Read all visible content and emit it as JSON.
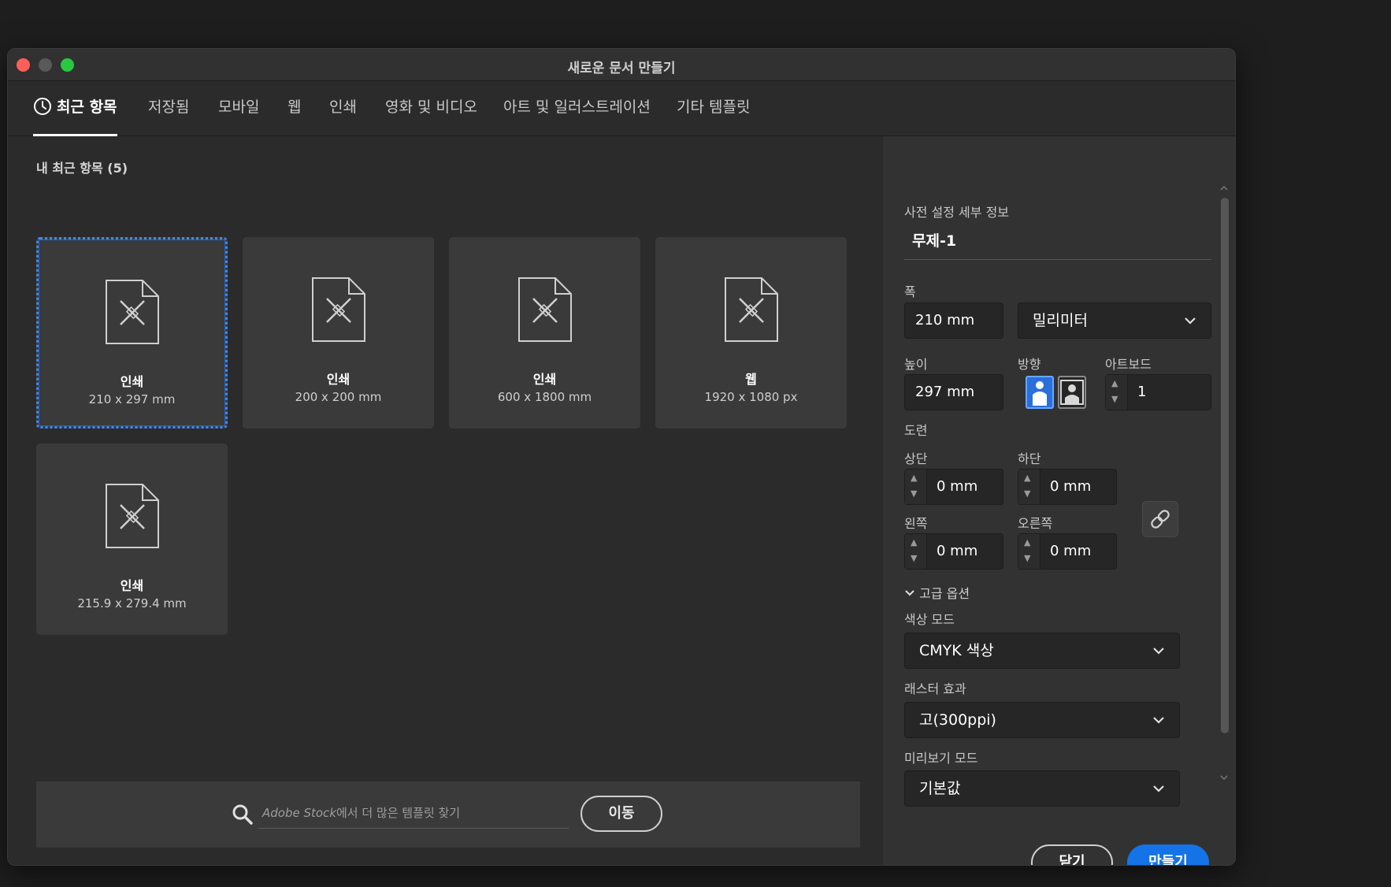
{
  "window": {
    "title": "새로운 문서 만들기"
  },
  "tabs": [
    {
      "label": "최근 항목",
      "icon": "clock-icon"
    },
    {
      "label": "저장됨"
    },
    {
      "label": "모바일"
    },
    {
      "label": "웹"
    },
    {
      "label": "인쇄"
    },
    {
      "label": "영화 및 비디오"
    },
    {
      "label": "아트 및 일러스트레이션"
    },
    {
      "label": "기타 템플릿"
    }
  ],
  "recent": {
    "title": "내 최근 항목 (5)",
    "cards": [
      {
        "name": "인쇄",
        "size": "210 x 297 mm",
        "selected": true
      },
      {
        "name": "인쇄",
        "size": "200 x 200 mm"
      },
      {
        "name": "인쇄",
        "size": "600 x 1800 mm"
      },
      {
        "name": "웹",
        "size": "1920 x 1080 px"
      },
      {
        "name": "인쇄",
        "size": "215.9 x 279.4 mm"
      }
    ]
  },
  "search": {
    "placeholder_brand": "Adobe Stock",
    "placeholder_rest": "에서 더 많은 템플릿 찾기",
    "go_label": "이동"
  },
  "preset": {
    "section_label": "사전 설정 세부 정보",
    "name": "무제-1",
    "width_label": "폭",
    "width_value": "210 mm",
    "unit_value": "밀리미터",
    "height_label": "높이",
    "height_value": "297 mm",
    "orientation_label": "방향",
    "artboard_label": "아트보드",
    "artboard_value": "1",
    "bleed_label": "도련",
    "top_label": "상단",
    "top_value": "0 mm",
    "bottom_label": "하단",
    "bottom_value": "0 mm",
    "left_label": "왼쪽",
    "left_value": "0 mm",
    "right_label": "오른쪽",
    "right_value": "0 mm",
    "advanced_label": "고급 옵션",
    "color_mode_label": "색상 모드",
    "color_mode_value": "CMYK 색상",
    "raster_label": "래스터 효과",
    "raster_value": "고(300ppi)",
    "preview_label": "미리보기 모드",
    "preview_value": "기본값"
  },
  "buttons": {
    "close": "닫기",
    "create": "만들기"
  },
  "colors": {
    "accent": "#1473e6",
    "selection": "#3d8af7"
  }
}
